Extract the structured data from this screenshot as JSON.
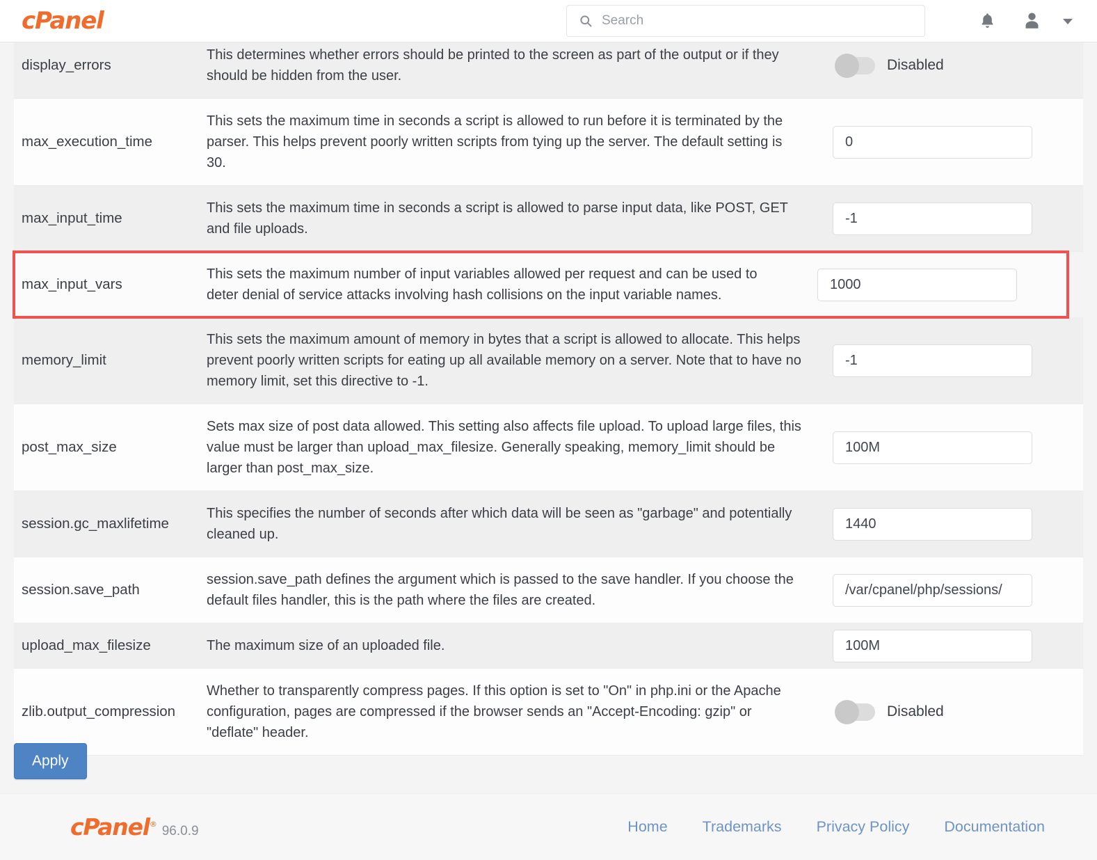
{
  "header": {
    "brand": "cPanel",
    "search_placeholder": "Search",
    "search_value": "",
    "search_icon": "search-icon",
    "bell_icon": "bell-icon",
    "user_icon": "user-icon",
    "caret_icon": "chevron-down-icon"
  },
  "rows": [
    {
      "name": "display_errors",
      "description": "This determines whether errors should be printed to the screen as part of the output or if they should be hidden from the user.",
      "control": "toggle",
      "toggle_state": "off",
      "toggle_label": "Disabled",
      "stripe": "alt",
      "clipped": true
    },
    {
      "name": "max_execution_time",
      "description": "This sets the maximum time in seconds a script is allowed to run before it is terminated by the parser. This helps prevent poorly written scripts from tying up the server. The default setting is 30.",
      "control": "input",
      "value": "0",
      "stripe": "normal"
    },
    {
      "name": "max_input_time",
      "description": "This sets the maximum time in seconds a script is allowed to parse input data, like POST, GET and file uploads.",
      "control": "input",
      "value": "-1",
      "stripe": "alt"
    },
    {
      "name": "max_input_vars",
      "description": "This sets the maximum number of input variables allowed per request and can be used to deter denial of service attacks involving hash collisions on the input variable names.",
      "control": "input",
      "value": "1000",
      "stripe": "normal",
      "highlighted": true
    },
    {
      "name": "memory_limit",
      "description": "This sets the maximum amount of memory in bytes that a script is allowed to allocate. This helps prevent poorly written scripts for eating up all available memory on a server. Note that to have no memory limit, set this directive to -1.",
      "control": "input",
      "value": "-1",
      "stripe": "alt"
    },
    {
      "name": "post_max_size",
      "description": "Sets max size of post data allowed. This setting also affects file upload. To upload large files, this value must be larger than upload_max_filesize. Generally speaking, memory_limit should be larger than post_max_size.",
      "control": "input",
      "value": "100M",
      "stripe": "normal"
    },
    {
      "name": "session.gc_maxlifetime",
      "description": "This specifies the number of seconds after which data will be seen as \"garbage\" and potentially cleaned up.",
      "control": "input",
      "value": "1440",
      "stripe": "alt"
    },
    {
      "name": "session.save_path",
      "description": "session.save_path defines the argument which is passed to the save handler. If you choose the default files handler, this is the path where the files are created.",
      "control": "input",
      "value": "/var/cpanel/php/sessions/",
      "stripe": "normal"
    },
    {
      "name": "upload_max_filesize",
      "description": "The maximum size of an uploaded file.",
      "control": "input",
      "value": "100M",
      "stripe": "alt"
    },
    {
      "name": "zlib.output_compression",
      "description": "Whether to transparently compress pages. If this option is set to \"On\" in php.ini or the Apache configuration, pages are compressed if the browser sends an \"Accept-Encoding: gzip\" or \"deflate\" header.",
      "control": "toggle",
      "toggle_state": "off",
      "toggle_label": "Disabled",
      "stripe": "normal"
    }
  ],
  "actions": {
    "apply_label": "Apply"
  },
  "footer": {
    "logo": "cPanel",
    "registered_mark": "®",
    "version": "96.0.9",
    "links": [
      "Home",
      "Trademarks",
      "Privacy Policy",
      "Documentation"
    ]
  },
  "colors": {
    "brand_orange": "#ef6c2d",
    "highlight_red": "#ef5350",
    "apply_blue": "#4e84c4",
    "link_blue": "#6e94c4"
  }
}
